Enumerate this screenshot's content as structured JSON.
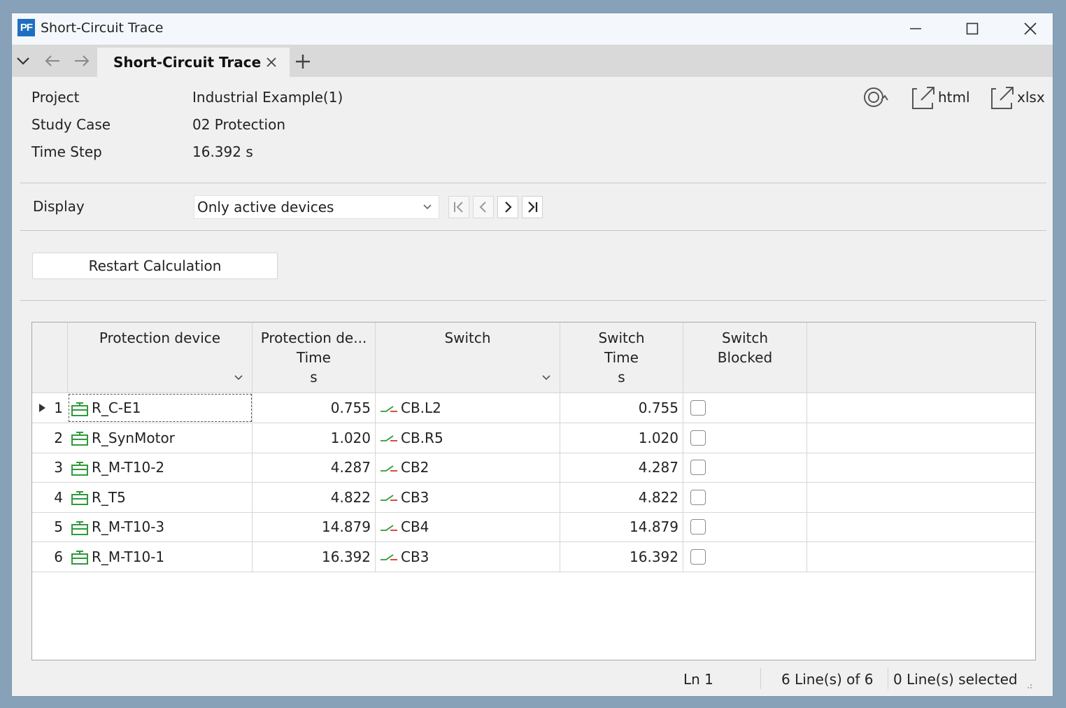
{
  "window": {
    "app_logo": "PF",
    "title": "Short-Circuit Trace"
  },
  "tabs": {
    "active_label": "Short-Circuit Trace"
  },
  "info": {
    "project_label": "Project",
    "project_value": "Industrial Example(1)",
    "study_case_label": "Study Case",
    "study_case_value": "02 Protection",
    "time_step_label": "Time Step",
    "time_step_value": "16.392 s"
  },
  "toolbar": {
    "refresh_icon": "refresh-icon",
    "html_label": "html",
    "xlsx_label": "xlsx"
  },
  "display": {
    "label": "Display",
    "selected": "Only active devices"
  },
  "restart_label": "Restart Calculation",
  "columns": [
    {
      "title": "Protection device",
      "unit": ""
    },
    {
      "title": "Protection de...",
      "subtitle": "Time",
      "unit": "s"
    },
    {
      "title": "Switch",
      "unit": ""
    },
    {
      "title": "Switch",
      "subtitle": "Time",
      "unit": "s"
    },
    {
      "title": "Switch",
      "subtitle": "Blocked",
      "unit": ""
    }
  ],
  "rows": [
    {
      "n": "1",
      "device": "R_C-E1",
      "dev_time": "0.755",
      "switch": "CB.L2",
      "sw_time": "0.755",
      "blocked": false
    },
    {
      "n": "2",
      "device": "R_SynMotor",
      "dev_time": "1.020",
      "switch": "CB.R5",
      "sw_time": "1.020",
      "blocked": false
    },
    {
      "n": "3",
      "device": "R_M-T10-2",
      "dev_time": "4.287",
      "switch": "CB2",
      "sw_time": "4.287",
      "blocked": false
    },
    {
      "n": "4",
      "device": "R_T5",
      "dev_time": "4.822",
      "switch": "CB3",
      "sw_time": "4.822",
      "blocked": false
    },
    {
      "n": "5",
      "device": "R_M-T10-3",
      "dev_time": "14.879",
      "switch": "CB4",
      "sw_time": "14.879",
      "blocked": false
    },
    {
      "n": "6",
      "device": "R_M-T10-1",
      "dev_time": "16.392",
      "switch": "CB3",
      "sw_time": "16.392",
      "blocked": false
    }
  ],
  "status": {
    "line": "Ln 1",
    "count": "6 Line(s) of 6",
    "selected": "0 Line(s) selected"
  },
  "colors": {
    "accent_blue": "#1f6fc1",
    "device_icon_green": "#2e9a3a",
    "switch_icon_green": "#2e9a3a",
    "switch_icon_red": "#d23a2a"
  }
}
